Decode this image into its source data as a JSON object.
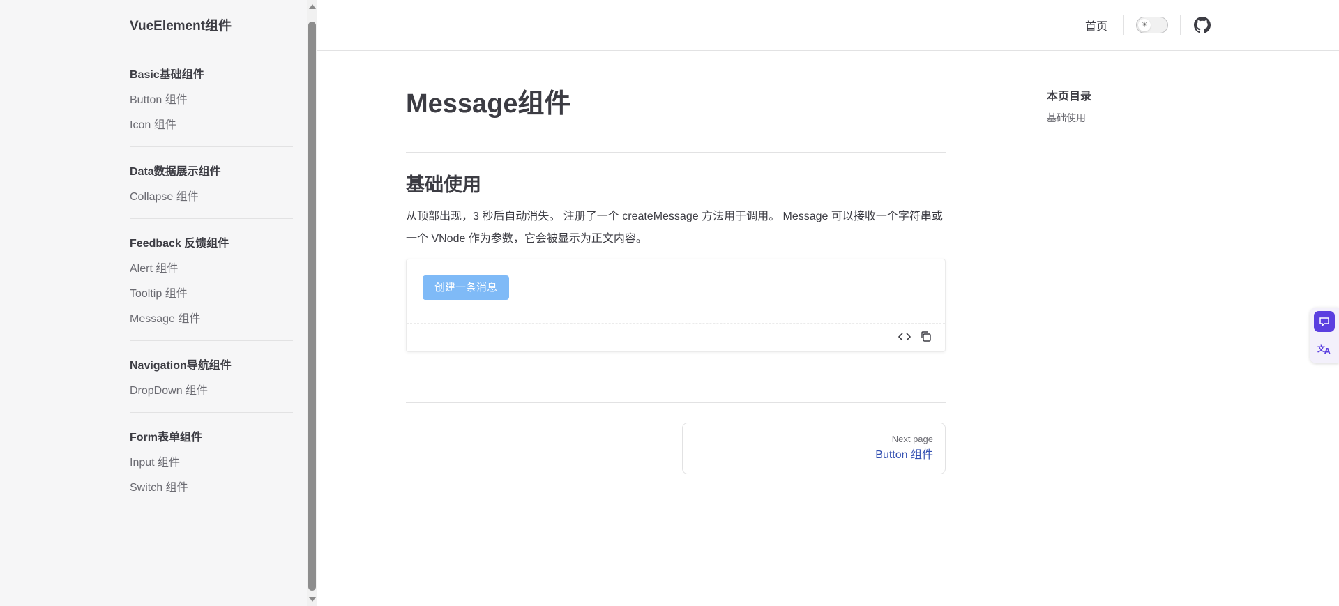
{
  "sidebar": {
    "brand": "VueElement组件",
    "groups": [
      {
        "title": "Basic基础组件",
        "items": [
          "Button 组件",
          "Icon 组件"
        ]
      },
      {
        "title": "Data数据展示组件",
        "items": [
          "Collapse 组件"
        ]
      },
      {
        "title": "Feedback 反馈组件",
        "items": [
          "Alert 组件",
          "Tooltip 组件",
          "Message 组件"
        ]
      },
      {
        "title": "Navigation导航组件",
        "items": [
          "DropDown 组件"
        ]
      },
      {
        "title": "Form表单组件",
        "items": [
          "Input 组件",
          "Switch 组件"
        ]
      }
    ]
  },
  "nav": {
    "home": "首页",
    "theme_icon": "sun-icon",
    "github_icon": "github-icon"
  },
  "main": {
    "title": "Message组件",
    "section_title": "基础使用",
    "description": "从顶部出现，3 秒后自动消失。 注册了一个 createMessage 方法用于调用。 Message 可以接收一个字符串或一个 VNode 作为参数，它会被显示为正文内容。",
    "demo": {
      "button_label": "创建一条消息",
      "button_color": "#7fbaf7",
      "code_icon": "code-icon",
      "copy_icon": "copy-icon"
    },
    "pager": {
      "next_label": "Next page",
      "next_link": "Button 组件",
      "link_color": "#3451b2"
    }
  },
  "toc": {
    "title": "本页目录",
    "items": [
      "基础使用"
    ]
  },
  "float_widget": {
    "accent": "#5b3fe0",
    "icons": [
      "chat-icon",
      "translate-icon"
    ]
  }
}
